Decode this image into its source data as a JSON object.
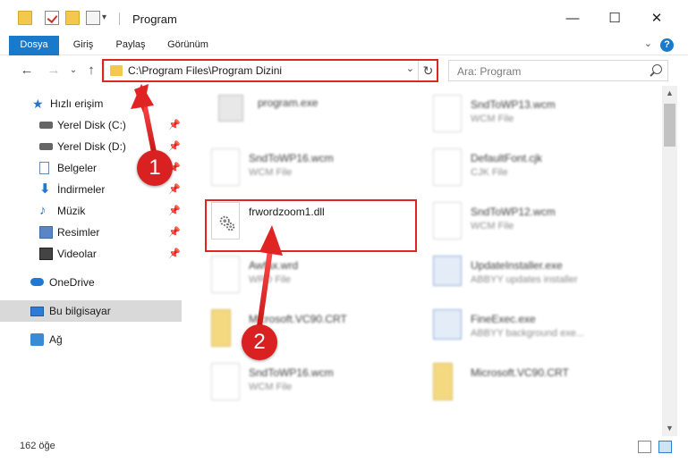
{
  "window": {
    "title": "Program",
    "minimize": "—",
    "maximize": "☐",
    "close": "✕"
  },
  "ribbon": {
    "tabs": [
      "Dosya",
      "Giriş",
      "Paylaş",
      "Görünüm"
    ],
    "collapse": "⌄",
    "help": "?"
  },
  "navigation": {
    "back": "←",
    "forward": "→",
    "recent": "⌄",
    "up": "↑"
  },
  "address": {
    "path": "C:\\Program Files\\Program Dizini",
    "dropdown": "⌄",
    "refresh": "↻"
  },
  "search": {
    "placeholder": "Ara: Program"
  },
  "sidebar": {
    "items": [
      {
        "label": "Hızlı erişim",
        "icon": "star-icon"
      },
      {
        "label": "Yerel Disk (C:)",
        "icon": "drive-icon"
      },
      {
        "label": "Yerel Disk (D:)",
        "icon": "drive-icon"
      },
      {
        "label": "Belgeler",
        "icon": "documents-icon"
      },
      {
        "label": "İndirmeler",
        "icon": "downloads-icon"
      },
      {
        "label": "Müzik",
        "icon": "music-icon"
      },
      {
        "label": "Resimler",
        "icon": "pictures-icon"
      },
      {
        "label": "Videolar",
        "icon": "videos-icon"
      },
      {
        "label": "OneDrive",
        "icon": "onedrive-icon"
      },
      {
        "label": "Bu bilgisayar",
        "icon": "computer-icon"
      },
      {
        "label": "Ağ",
        "icon": "network-icon"
      }
    ],
    "pin": "📌"
  },
  "files": [
    {
      "name": "program.exe",
      "type": ""
    },
    {
      "name": "SndToWP13.wcm",
      "type": "WCM File"
    },
    {
      "name": "SndToWP16.wcm",
      "type": "WCM File"
    },
    {
      "name": "DefaultFont.cjk",
      "type": "CJK File"
    },
    {
      "name": "frwordzoom1.dll",
      "type": ""
    },
    {
      "name": "SndToWP12.wcm",
      "type": "WCM File"
    },
    {
      "name": "Awfax.wrd",
      "type": "WRD File"
    },
    {
      "name": "UpdateInstaller.exe",
      "type": "ABBYY updates installer"
    },
    {
      "name": "Microsoft.VC90.CRT",
      "type": ""
    },
    {
      "name": "FineExec.exe",
      "type": "ABBYY background exe..."
    },
    {
      "name": "SndToWP16.wcm",
      "type": "WCM File"
    },
    {
      "name": "Microsoft.VC90.CRT",
      "type": ""
    }
  ],
  "status": {
    "count": "162 öğe"
  },
  "annotations": {
    "step1": "1",
    "step2": "2"
  },
  "colors": {
    "accent": "#1979ca",
    "highlight": "#e02424",
    "badge": "#d92121"
  }
}
